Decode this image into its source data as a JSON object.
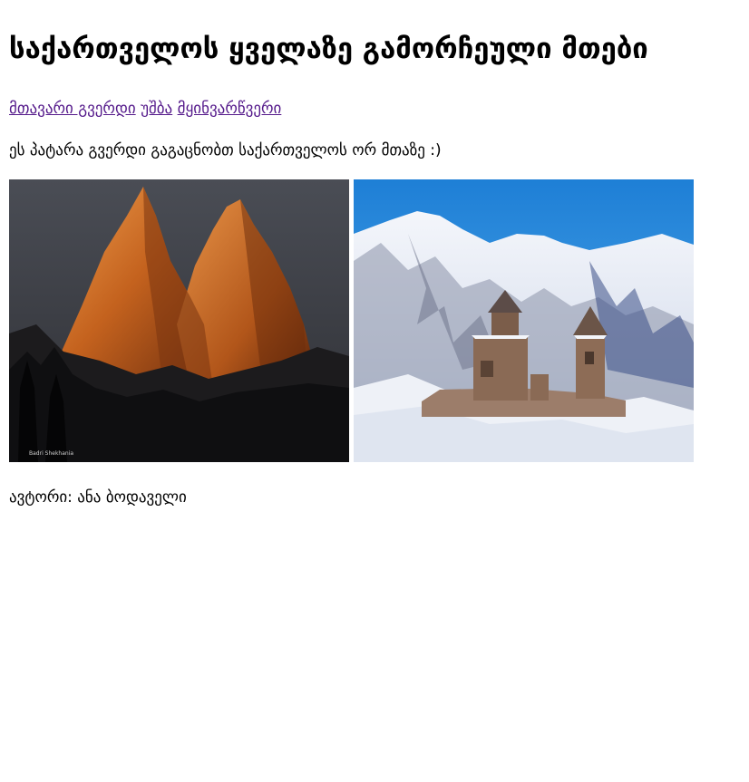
{
  "header": {
    "title": "საქართველოს ყველაზე გამორჩეული მთები"
  },
  "nav": {
    "links": [
      {
        "label": "მთავარი გვერდი"
      },
      {
        "label": "უშბა"
      },
      {
        "label": "მყინვარწვერი"
      }
    ]
  },
  "main": {
    "intro": "ეს პატარა გვერდი გაგაცნობთ საქართველოს ორ მთაზე :)",
    "images": [
      {
        "subject": "ushba-mountain-sunset",
        "caption_watermark": "Badri Shekhania"
      },
      {
        "subject": "kazbek-gergeti-trinity-church"
      }
    ]
  },
  "footer": {
    "author": "ავტორი: ანა ბოდაველი"
  },
  "colors": {
    "link": "#551a8b",
    "text": "#000000",
    "background": "#ffffff"
  }
}
